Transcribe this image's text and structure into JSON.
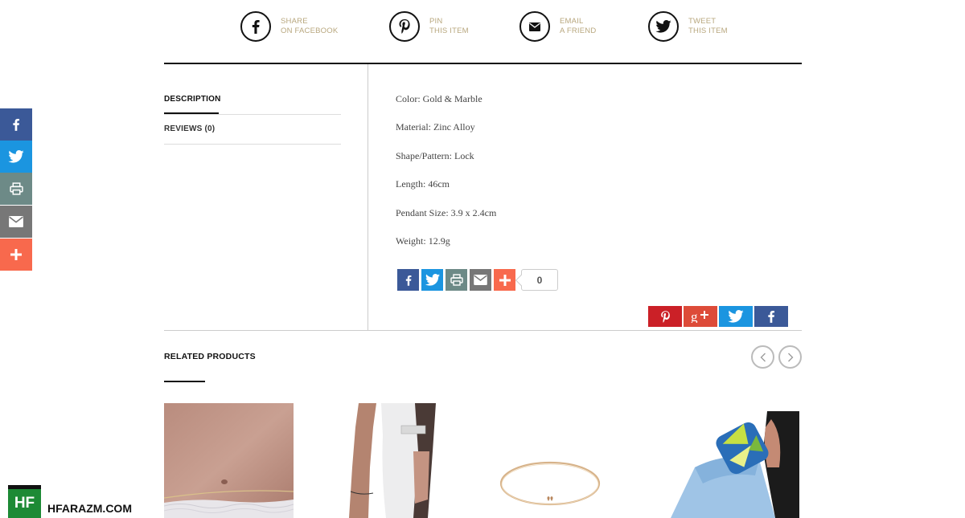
{
  "share_row": [
    {
      "line1": "SHARE",
      "line2": "ON FACEBOOK",
      "icon": "facebook-icon"
    },
    {
      "line1": "PIN",
      "line2": "THIS ITEM",
      "icon": "pinterest-icon"
    },
    {
      "line1": "EMAIL",
      "line2": "A FRIEND",
      "icon": "envelope-icon"
    },
    {
      "line1": "TWEET",
      "line2": "THIS ITEM",
      "icon": "twitter-icon"
    }
  ],
  "tabs": {
    "description": "DESCRIPTION",
    "reviews": "REVIEWS (0)"
  },
  "specs": [
    "Color: Gold & Marble",
    "Material: Zinc Alloy",
    "Shape/Pattern: Lock",
    "Length: 46cm",
    "Pendant Size: 3.9 x 2.4cm",
    "Weight: 12.9g"
  ],
  "share_count": "0",
  "related": {
    "title": "RELATED PRODUCTS"
  },
  "side_bar": [
    "facebook-icon",
    "twitter-icon",
    "print-icon",
    "email-icon",
    "plus-icon"
  ],
  "colors": {
    "facebook": "#3b5998",
    "twitter": "#1b95e0",
    "print": "#6d8a87",
    "email": "#777777",
    "addthis": "#f8694d",
    "pinterest": "#cb2027",
    "googleplus": "#dd4b39",
    "gold_text": "#b8a77e"
  },
  "watermark": {
    "logo": "HF",
    "text": "HFARAZM.COM"
  }
}
